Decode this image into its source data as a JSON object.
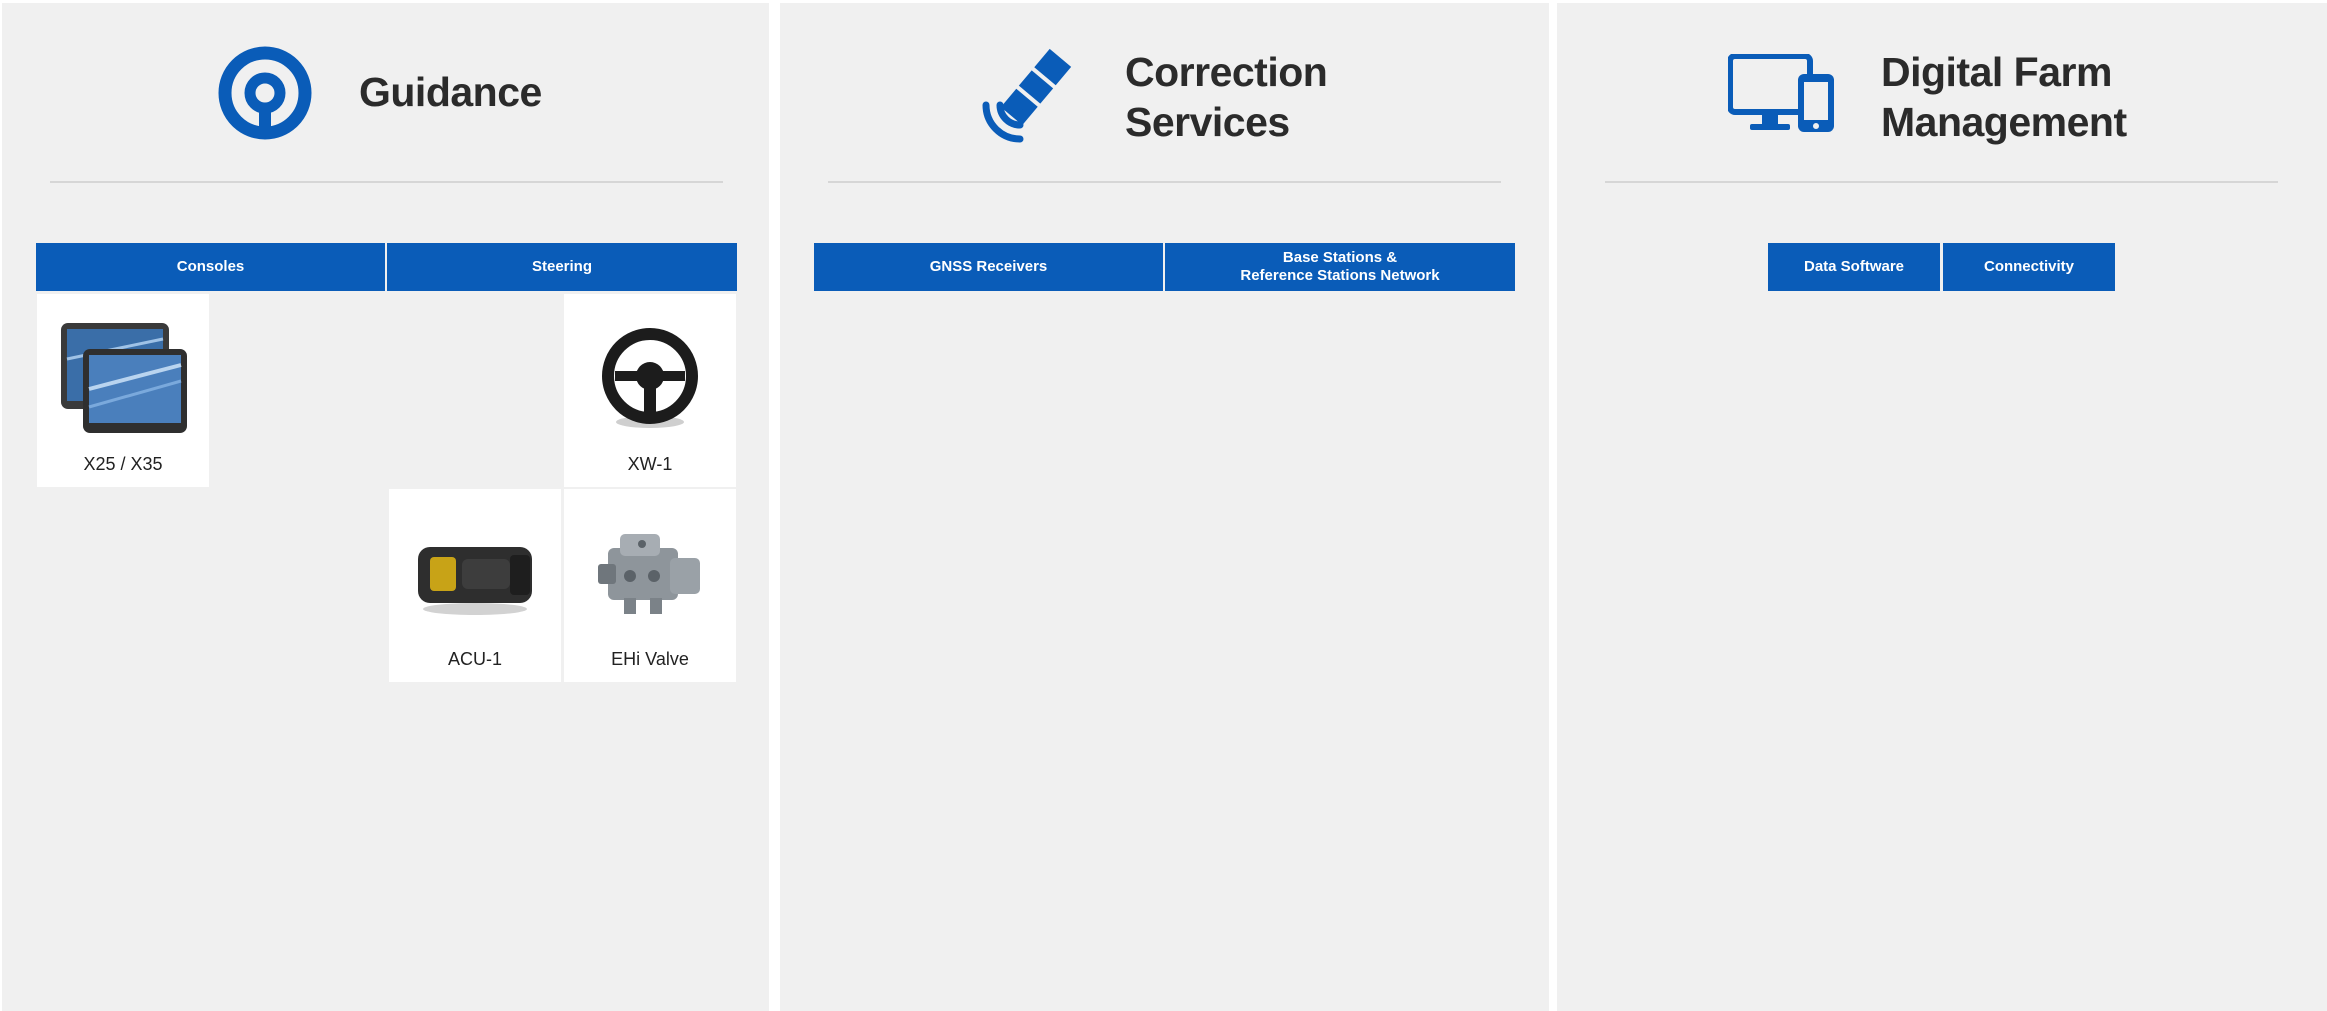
{
  "sections": [
    {
      "title": "Guidance",
      "icon": "steering-wheel-icon",
      "tabs": [
        "Consoles",
        "Steering"
      ],
      "products": [
        {
          "name": "X25 / X35",
          "icon": "console-displays-icon"
        },
        {
          "name": "XW-1",
          "icon": "steering-wheel-icon"
        },
        {
          "name": "ACU-1",
          "icon": "control-unit-icon"
        },
        {
          "name": "EHi Valve",
          "icon": "hydraulic-valve-icon"
        }
      ]
    },
    {
      "title_line1": "Correction",
      "title_line2": "Services",
      "icon": "satellite-icon",
      "tabs": [
        "GNSS Receivers",
        "Base Stations &",
        "Reference Stations Network"
      ]
    },
    {
      "title_line1": "Digital Farm",
      "title_line2": "Management",
      "icon": "desktop-mobile-icon",
      "tabs": [
        "Data Software",
        "Connectivity"
      ]
    }
  ],
  "colors": {
    "accent": "#0a5cb8",
    "panel": "#f0f0f0",
    "text": "#2b2b2b"
  }
}
